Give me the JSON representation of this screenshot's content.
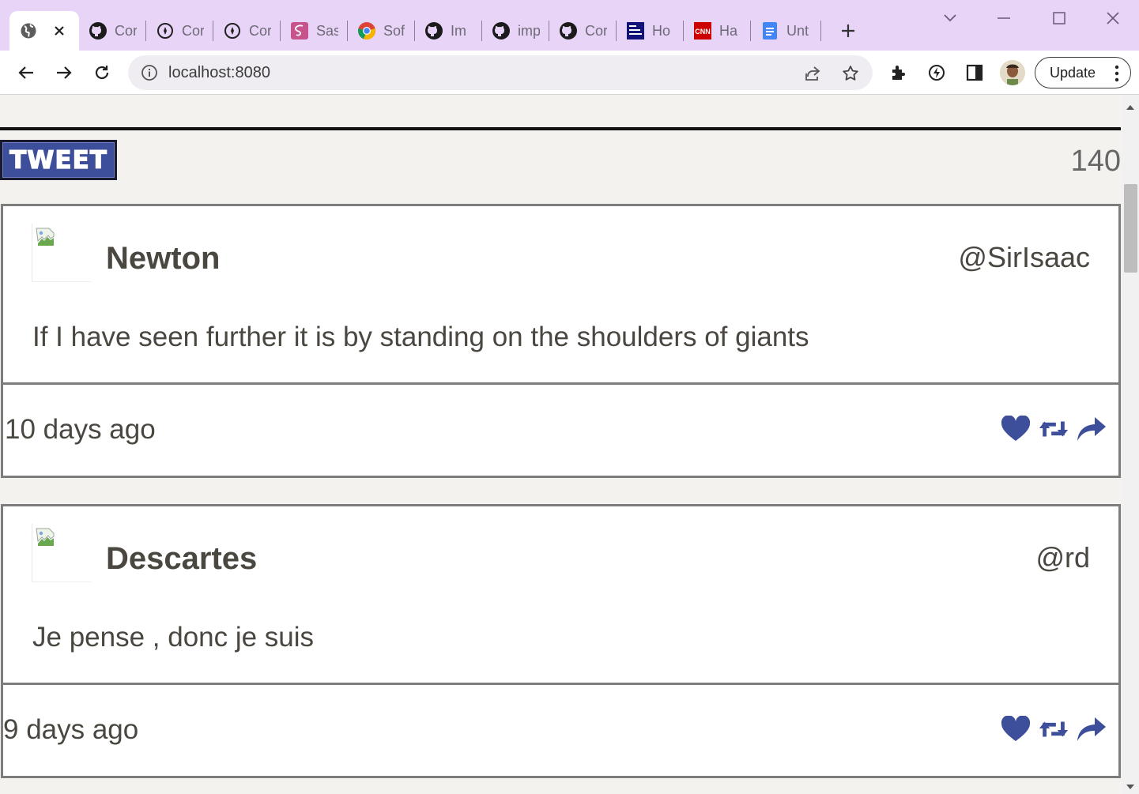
{
  "browser": {
    "tabs": [
      {
        "title": "",
        "icon": "globe-icon",
        "active": true
      },
      {
        "title": "Cor",
        "icon": "github-icon"
      },
      {
        "title": "Cor",
        "icon": "compass-icon"
      },
      {
        "title": "Cor",
        "icon": "compass-icon"
      },
      {
        "title": "Sas",
        "icon": "sass-icon"
      },
      {
        "title": "Sof",
        "icon": "chrome-icon"
      },
      {
        "title": "Im",
        "icon": "github-icon"
      },
      {
        "title": "imp",
        "icon": "github-icon"
      },
      {
        "title": "Cor",
        "icon": "github-icon"
      },
      {
        "title": "Ho",
        "icon": "sitewizard-icon"
      },
      {
        "title": "Ha",
        "icon": "cnn-icon"
      },
      {
        "title": "Unt",
        "icon": "docs-icon"
      }
    ],
    "address": "localhost:8080",
    "update_label": "Update",
    "colors": {
      "tabstrip": "#e7d4f7",
      "accent": "#3d4e9a"
    }
  },
  "composer": {
    "tweet_button_label": "TWEET",
    "char_counter": "140"
  },
  "tweets": [
    {
      "name": "Newton",
      "handle": "@SirIsaac",
      "text": "If I have seen further it is by standing on the shoulders of giants",
      "time": "10 days ago"
    },
    {
      "name": "Descartes",
      "handle": "@rd",
      "text": "Je pense , donc je suis",
      "time": "9 days ago"
    }
  ]
}
